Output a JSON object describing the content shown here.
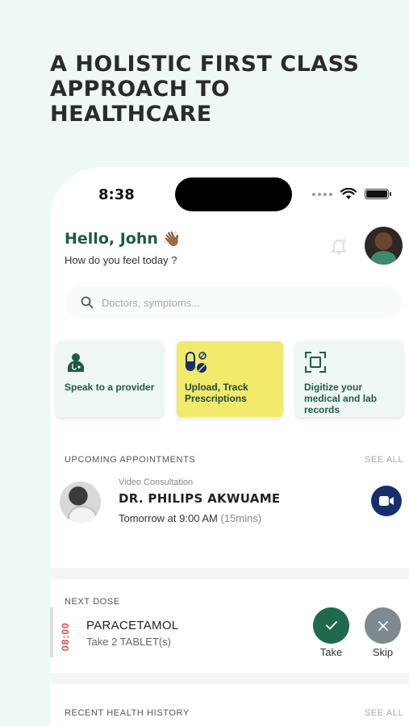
{
  "headline": "A HOLISTIC FIRST CLASS APPROACH TO HEALTHCARE",
  "status": {
    "time": "8:38"
  },
  "header": {
    "greeting": "Hello, John",
    "wave": "👋🏾",
    "subtitle": "How do you feel today ?"
  },
  "search": {
    "placeholder": "Doctors, symptoms..."
  },
  "quick_actions": [
    {
      "label": "Speak to a provider",
      "icon": "doctor-icon"
    },
    {
      "label": "Upload, Track Prescriptions",
      "icon": "pills-icon"
    },
    {
      "label": "Digitize your medical and lab records",
      "icon": "scan-icon"
    }
  ],
  "appointments": {
    "title": "UPCOMING APPOINTMENTS",
    "see_all": "SEE ALL",
    "item": {
      "type": "Video Consultation",
      "doctor": "DR. PHILIPS AKWUAME",
      "time": "Tomorrow at 9:00 AM",
      "duration": "(15mins)"
    }
  },
  "next_dose": {
    "title": "NEXT DOSE",
    "time": "08:00",
    "medication": "PARACETAMOL",
    "dosage": "Take 2 TABLET(s)",
    "take_label": "Take",
    "skip_label": "Skip"
  },
  "health_history": {
    "title": "RECENT HEALTH HISTORY",
    "see_all": "SEE ALL"
  },
  "colors": {
    "background": "#eef8f5",
    "brand_green": "#1f5a45",
    "highlight_card": "#f1ea6b",
    "video_button": "#172e6e",
    "take_button": "#1f6a4c",
    "skip_button": "#7e8a90",
    "dose_time": "#e14b4b"
  }
}
